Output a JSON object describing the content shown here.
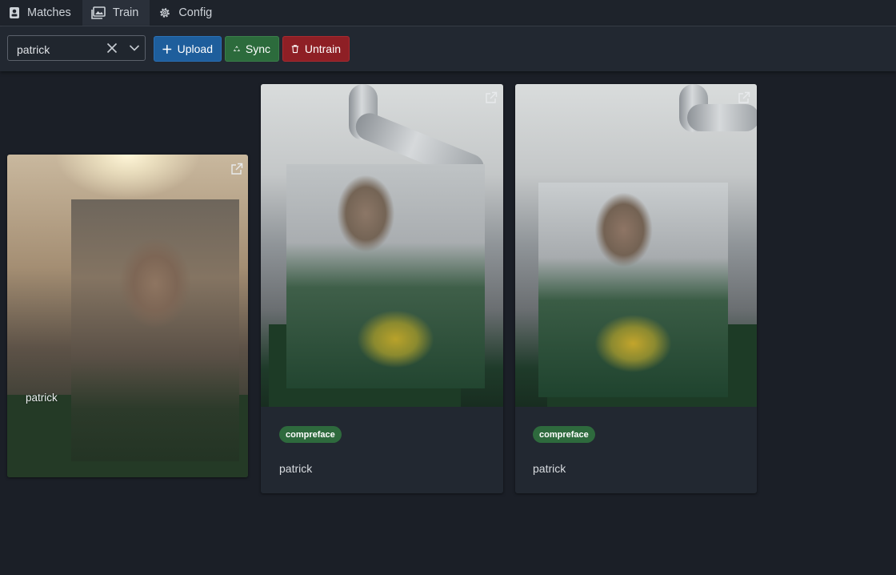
{
  "tabs": [
    {
      "label": "Matches",
      "icon": "id-card-icon",
      "active": false
    },
    {
      "label": "Train",
      "icon": "images-icon",
      "active": true
    },
    {
      "label": "Config",
      "icon": "gear-icon",
      "active": false
    }
  ],
  "toolbar": {
    "select_value": "patrick",
    "upload_label": "Upload",
    "sync_label": "Sync",
    "untrain_label": "Untrain"
  },
  "cards": [
    {
      "overlay_name": "patrick",
      "icon": "external-link-icon"
    },
    {
      "badge": "compreface",
      "name": "patrick",
      "icon": "external-link-icon"
    },
    {
      "badge": "compreface",
      "name": "patrick",
      "icon": "external-link-icon"
    }
  ],
  "colors": {
    "upload": "#1e5e9c",
    "sync": "#2c6b3c",
    "untrain": "#8e1f25",
    "badge": "#2e6a3d"
  }
}
